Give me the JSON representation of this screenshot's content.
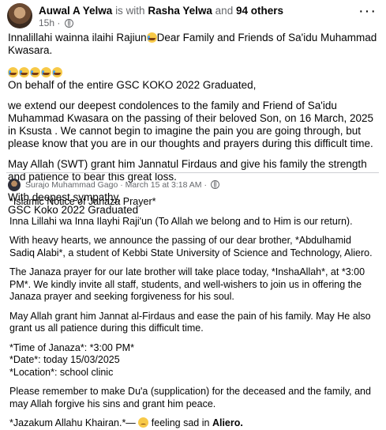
{
  "post": {
    "author": "Auwal A Yelwa",
    "with_text": "is with",
    "tagged": "Rasha Yelwa",
    "and_text": "and",
    "others": "94 others",
    "time": "15h",
    "more_label": "···"
  },
  "body": {
    "line1": "Innalillahi wainna ilaihi Rajiun",
    "line1b": "Dear Family and Friends of Sa'idu Muhammad Kwasara.",
    "p2": "On behalf of the entire GSC KOKO 2022 Graduated,",
    "p3": " we extend our deepest condolences to the family and Friend of Sa'idu Muhammad Kwasara on the passing of their beloved Son, on 16 March, 2025 in Ksusta . We cannot begin to imagine the pain you are going through, but please know that you are in our thoughts and prayers during this difficult time.",
    "p4": "May Allah (SWT) grant him Jannatul Firdaus and give his family the strength and patience to bear this great loss.",
    "p5a": "With deepest sympathy,",
    "p5b": "GSC Koko 2022 Graduated"
  },
  "shared": {
    "author": "Surajo Muhammad Gago",
    "timestamp": "March 15 at 3:18 AM",
    "dot": "·",
    "l1": "*Islamic Notice of Janaza Prayer*",
    "l2": "Inna Lillahi wa Inna Ilayhi Raji'un (To Allah we belong and to Him is our return).",
    "l3": "With heavy hearts, we announce the passing of our dear brother, *Abdulhamid Sadiq Alabi*, a student of Kebbi State University of Science and Technology, Aliero.",
    "l4": "The Janaza prayer for our late brother will take place today, *InshaAllah*, at *3:00 PM*. We kindly invite all staff, students, and well-wishers to join us in offering the Janaza prayer and seeking forgiveness for his soul.",
    "l5": "May Allah grant him Jannat al-Firdaus and ease the pain of his family. May He also grant us all patience during this difficult time.",
    "l6a": "*Time of Janaza*: *3:00 PM*",
    "l6b": "*Date*:  today 15/03/2025",
    "l6c": "*Location*: school clinic",
    "l7": "Please remember to make Du'a (supplication) for the deceased and the family, and may Allah forgive his sins and grant him peace.",
    "l8a": "*Jazakum Allahu Khairan.*—",
    "l8b": "feeling sad in",
    "l8c": "Aliero."
  },
  "icons": {
    "privacy": "globe-icon",
    "emoji_main": "crying-face-emoji",
    "emoji_feeling": "sad-face-emoji"
  }
}
